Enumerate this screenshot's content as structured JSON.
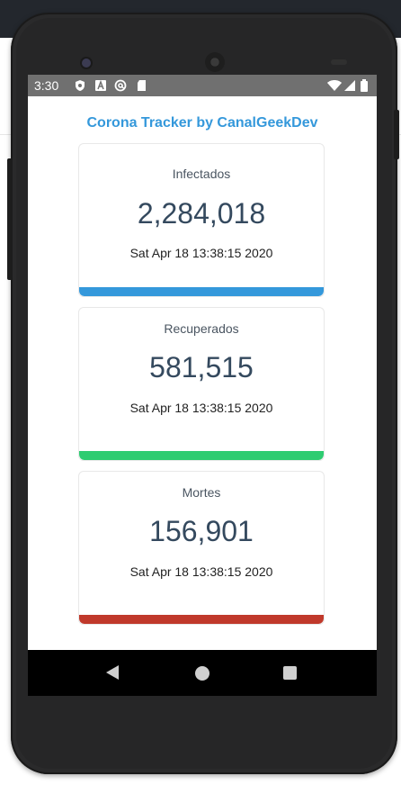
{
  "status_bar": {
    "time": "3:30",
    "icons": [
      "shield-icon",
      "a-icon",
      "at-sign-icon",
      "sd-card-icon"
    ],
    "right_icons": [
      "wifi-icon",
      "signal-icon",
      "battery-icon"
    ]
  },
  "app": {
    "title": "Corona Tracker by CanalGeekDev",
    "title_color": "#3498db"
  },
  "cards": [
    {
      "label": "Infectados",
      "value": "2,284,018",
      "date": "Sat Apr 18 13:38:15 2020",
      "color": "#3498db"
    },
    {
      "label": "Recuperados",
      "value": "581,515",
      "date": "Sat Apr 18 13:38:15 2020",
      "color": "#2ecc71"
    },
    {
      "label": "Mortes",
      "value": "156,901",
      "date": "Sat Apr 18 13:38:15 2020",
      "color": "#c0392b"
    }
  ],
  "nav_bar": {
    "buttons": [
      "back-icon",
      "home-icon",
      "recent-apps-icon"
    ]
  }
}
